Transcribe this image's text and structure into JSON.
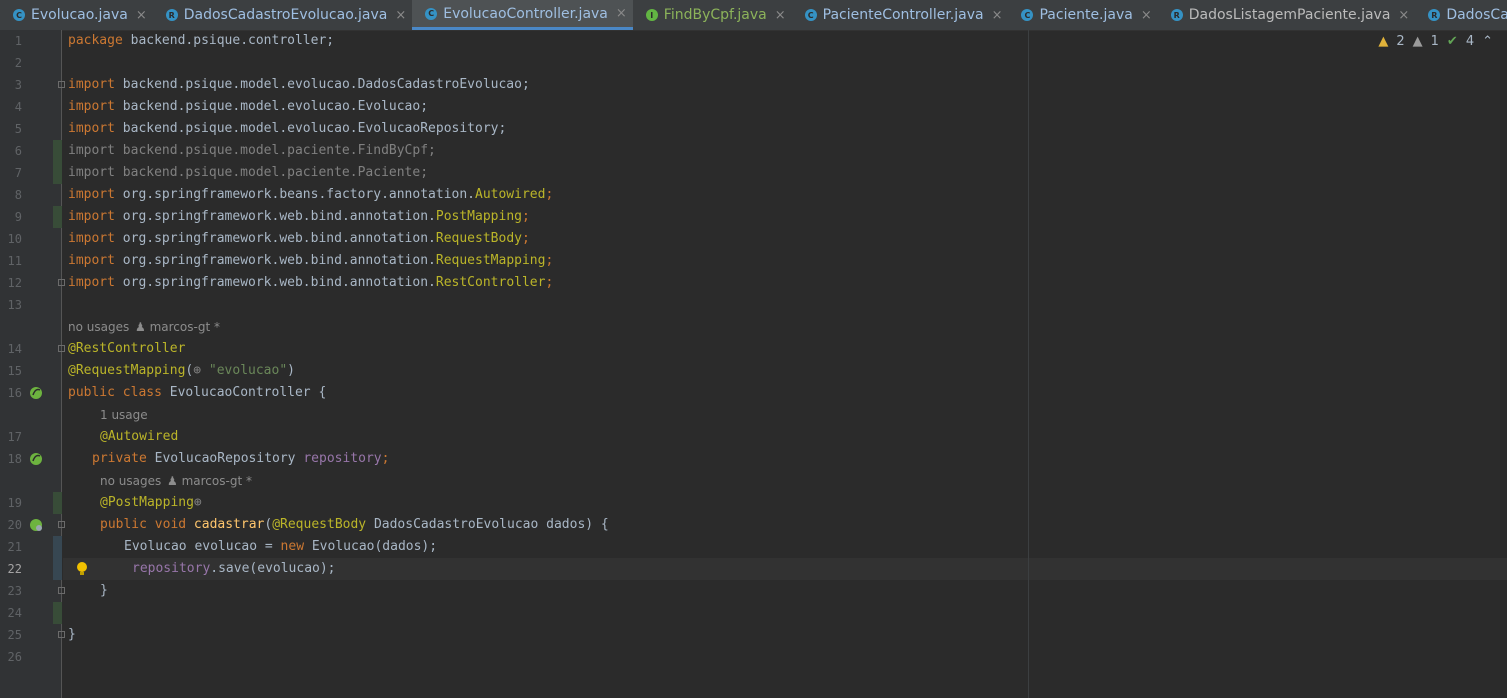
{
  "tabs": [
    {
      "label": "Evolucao.java",
      "icon": "C",
      "icon_name": "class-icon",
      "active": false,
      "color": "blue"
    },
    {
      "label": "DadosCadastroEvolucao.java",
      "icon": "R",
      "icon_name": "record-icon",
      "active": false,
      "color": "blue"
    },
    {
      "label": "EvolucaoController.java",
      "icon": "C",
      "icon_name": "class-icon",
      "active": true,
      "color": "blue"
    },
    {
      "label": "FindByCpf.java",
      "icon": "I",
      "icon_name": "interface-icon",
      "active": false,
      "color": "green"
    },
    {
      "label": "PacienteController.java",
      "icon": "C",
      "icon_name": "class-icon",
      "active": false,
      "color": "blue"
    },
    {
      "label": "Paciente.java",
      "icon": "C",
      "icon_name": "class-icon",
      "active": false,
      "color": "blue"
    },
    {
      "label": "DadosListagemPaciente.java",
      "icon": "R",
      "icon_name": "record-icon",
      "active": false,
      "color": "plain"
    },
    {
      "label": "DadosCadastro",
      "icon": "R",
      "icon_name": "record-icon",
      "active": false,
      "color": "blue"
    }
  ],
  "tab_close": "×",
  "inspections": {
    "warnings": "2",
    "weak_warnings": "1",
    "ok": "4"
  },
  "line_numbers": [
    "1",
    "2",
    "3",
    "4",
    "5",
    "6",
    "7",
    "8",
    "9",
    "10",
    "11",
    "12",
    "13",
    "14",
    "15",
    "16",
    "17",
    "18",
    "19",
    "20",
    "21",
    "22",
    "23",
    "24",
    "25",
    "26"
  ],
  "hints": {
    "class_usages": "no usages",
    "class_author": "marcos-gt *",
    "field_usages": "1 usage",
    "method_usages": "no usages",
    "method_author": "marcos-gt *"
  },
  "code": {
    "l1": {
      "a": "package",
      "b": " backend.psique.controller;"
    },
    "l3": {
      "a": "import",
      "b": " backend.psique.model.evolucao.DadosCadastroEvolucao;"
    },
    "l4": {
      "a": "import",
      "b": " backend.psique.model.evolucao.Evolucao;"
    },
    "l5": {
      "a": "import",
      "b": " backend.psique.model.evolucao.EvolucaoRepository;"
    },
    "l6": "import backend.psique.model.paciente.FindByCpf;",
    "l7": "import backend.psique.model.paciente.Paciente;",
    "l8": {
      "a": "import",
      "b": " org.springframework.beans.factory.annotation.",
      "c": "Autowired",
      ";": ";"
    },
    "l9": {
      "a": "import",
      "b": " org.springframework.web.bind.annotation.",
      "c": "PostMapping",
      ";": ";"
    },
    "l10": {
      "a": "import",
      "b": " org.springframework.web.bind.annotation.",
      "c": "RequestBody",
      ";": ";"
    },
    "l11": {
      "a": "import",
      "b": " org.springframework.web.bind.annotation.",
      "c": "RequestMapping",
      ";": ";"
    },
    "l12": {
      "a": "import",
      "b": " org.springframework.web.bind.annotation.",
      "c": "RestController",
      ";": ";"
    },
    "l14": "@RestController",
    "l15": {
      "a": "@RequestMapping",
      "b": "(",
      "c": "\"evolucao\"",
      "d": ")"
    },
    "l16": {
      "a": "public class",
      "b": " EvolucaoController {"
    },
    "l17": "@Autowired",
    "l18": {
      "a": "private",
      "b": " EvolucaoRepository ",
      "c": "repository",
      "d": ";"
    },
    "l19": "@PostMapping",
    "l20": {
      "a": "public void",
      "b": "cadastrar",
      "c": "(",
      "d": "@RequestBody",
      "e": " DadosCadastroEvolucao dados) {"
    },
    "l21": {
      "a": "Evolucao evolucao = ",
      "b": "new",
      "c": " Evolucao(dados);"
    },
    "l22": {
      "a": "repository",
      "b": ".save(evolucao);"
    },
    "l23": "}",
    "l25": "}"
  }
}
